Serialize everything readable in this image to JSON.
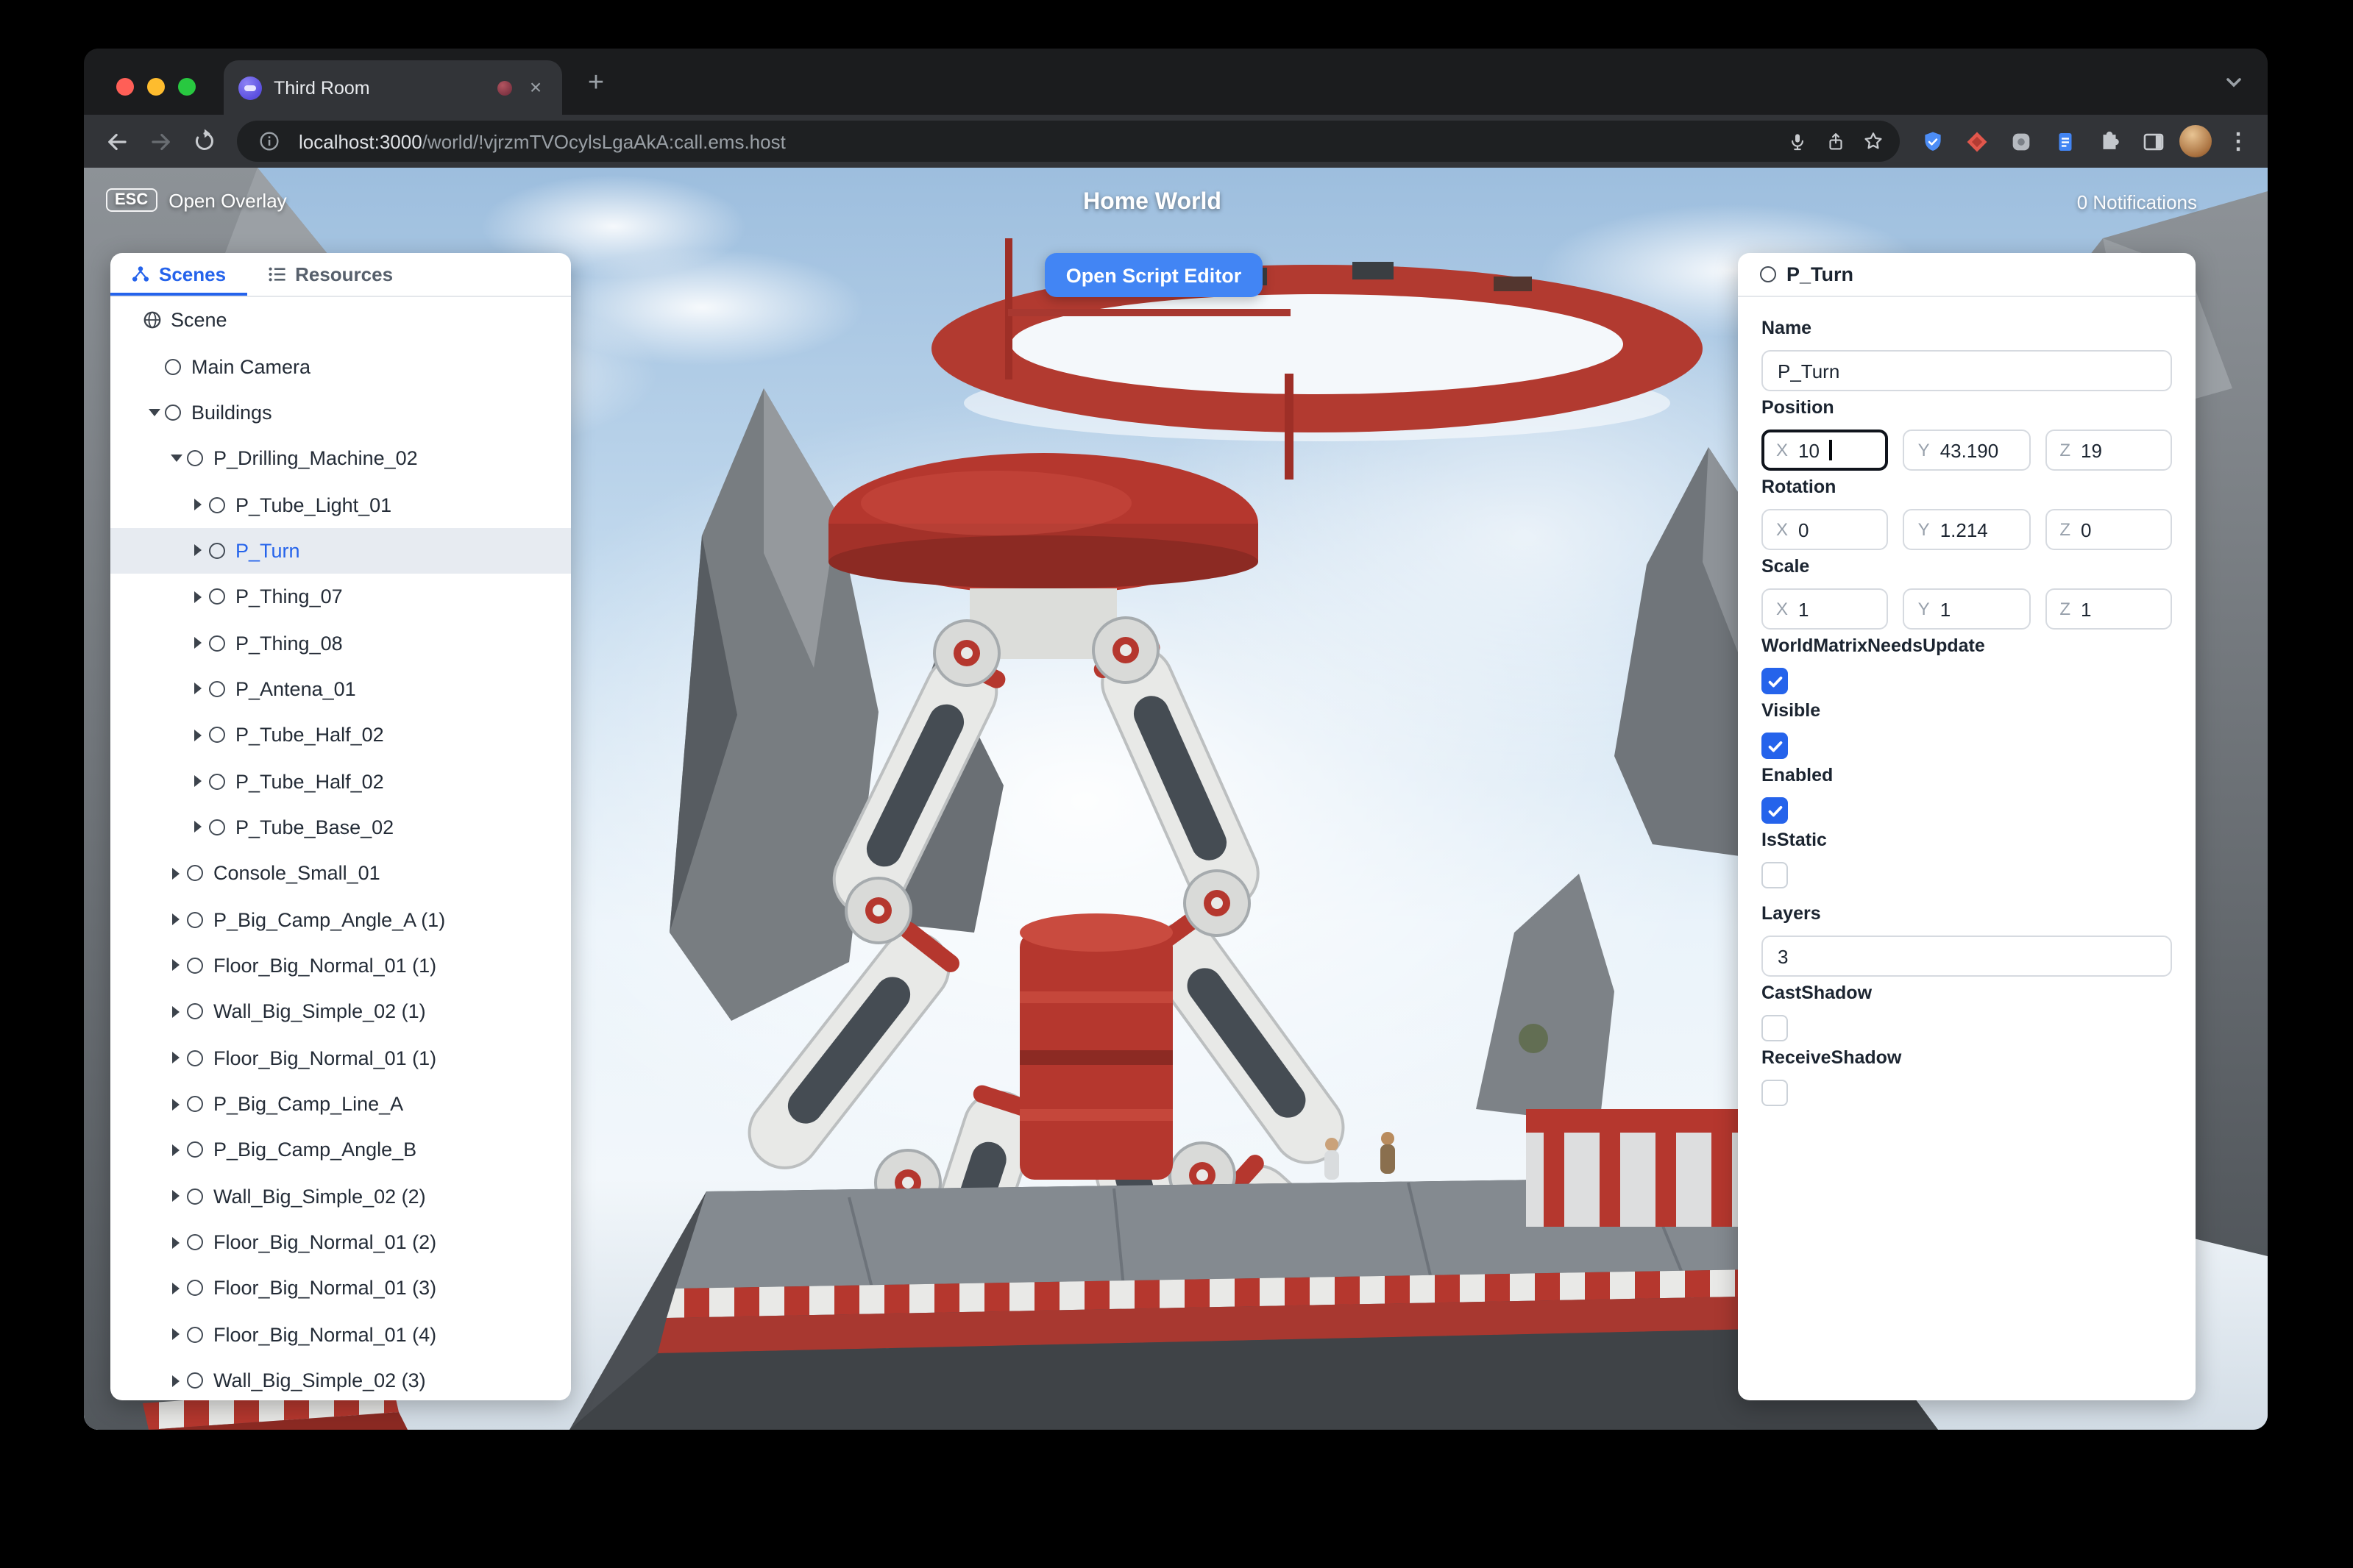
{
  "colors": {
    "accent_blue": "#2563eb",
    "button_blue": "#4285f4",
    "selected_row_bg": "#e7ebf1",
    "machine_red": "#b5372e"
  },
  "browser": {
    "tab_title": "Third Room",
    "close_tab_glyph": "×",
    "new_tab_glyph": "+",
    "overflow_glyph": "⋮",
    "url_host": "localhost:3000",
    "url_path": "/world/!vjrzmTVOcylsLgaAkA:call.ems.host"
  },
  "hud": {
    "esc_badge": "ESC",
    "open_overlay_label": "Open Overlay",
    "world_title": "Home World",
    "notifications_label": "0 Notifications",
    "open_script_editor_label": "Open Script Editor"
  },
  "left_panel": {
    "tabs": [
      {
        "label": "Scenes",
        "active": true
      },
      {
        "label": "Resources",
        "active": false
      }
    ],
    "tree": [
      {
        "label": "Scene",
        "depth": 0,
        "icon": "globe",
        "caret": null
      },
      {
        "label": "Main Camera",
        "depth": 1,
        "icon": "circle",
        "caret": null
      },
      {
        "label": "Buildings",
        "depth": 1,
        "icon": "circle",
        "caret": "down"
      },
      {
        "label": "P_Drilling_Machine_02",
        "depth": 2,
        "icon": "circle",
        "caret": "down"
      },
      {
        "label": "P_Tube_Light_01",
        "depth": 3,
        "icon": "circle",
        "caret": "right"
      },
      {
        "label": "P_Turn",
        "depth": 3,
        "icon": "circle",
        "caret": "right",
        "selected": true
      },
      {
        "label": "P_Thing_07",
        "depth": 3,
        "icon": "circle",
        "caret": "right"
      },
      {
        "label": "P_Thing_08",
        "depth": 3,
        "icon": "circle",
        "caret": "right"
      },
      {
        "label": "P_Antena_01",
        "depth": 3,
        "icon": "circle",
        "caret": "right"
      },
      {
        "label": "P_Tube_Half_02",
        "depth": 3,
        "icon": "circle",
        "caret": "right"
      },
      {
        "label": "P_Tube_Half_02",
        "depth": 3,
        "icon": "circle",
        "caret": "right"
      },
      {
        "label": "P_Tube_Base_02",
        "depth": 3,
        "icon": "circle",
        "caret": "right"
      },
      {
        "label": "Console_Small_01",
        "depth": 2,
        "icon": "circle",
        "caret": "right"
      },
      {
        "label": "P_Big_Camp_Angle_A (1)",
        "depth": 2,
        "icon": "circle",
        "caret": "right"
      },
      {
        "label": "Floor_Big_Normal_01 (1)",
        "depth": 2,
        "icon": "circle",
        "caret": "right"
      },
      {
        "label": "Wall_Big_Simple_02 (1)",
        "depth": 2,
        "icon": "circle",
        "caret": "right"
      },
      {
        "label": "Floor_Big_Normal_01 (1)",
        "depth": 2,
        "icon": "circle",
        "caret": "right"
      },
      {
        "label": "P_Big_Camp_Line_A",
        "depth": 2,
        "icon": "circle",
        "caret": "right"
      },
      {
        "label": "P_Big_Camp_Angle_B",
        "depth": 2,
        "icon": "circle",
        "caret": "right"
      },
      {
        "label": "Wall_Big_Simple_02 (2)",
        "depth": 2,
        "icon": "circle",
        "caret": "right"
      },
      {
        "label": "Floor_Big_Normal_01 (2)",
        "depth": 2,
        "icon": "circle",
        "caret": "right"
      },
      {
        "label": "Floor_Big_Normal_01 (3)",
        "depth": 2,
        "icon": "circle",
        "caret": "right"
      },
      {
        "label": "Floor_Big_Normal_01 (4)",
        "depth": 2,
        "icon": "circle",
        "caret": "right"
      },
      {
        "label": "Wall_Big_Simple_02 (3)",
        "depth": 2,
        "icon": "circle",
        "caret": "right"
      }
    ]
  },
  "inspector": {
    "header_title": "P_Turn",
    "axes": [
      "X",
      "Y",
      "Z"
    ],
    "focused_field": "position.x",
    "name_field": {
      "label": "Name",
      "value": "P_Turn"
    },
    "position": {
      "label": "Position",
      "x": "10",
      "y": "43.190",
      "z": "19"
    },
    "rotation": {
      "label": "Rotation",
      "x": "0",
      "y": "1.214",
      "z": "0"
    },
    "scale": {
      "label": "Scale",
      "x": "1",
      "y": "1",
      "z": "1"
    },
    "bool_fields": [
      {
        "label": "WorldMatrixNeedsUpdate",
        "checked": true
      },
      {
        "label": "Visible",
        "checked": true
      },
      {
        "label": "Enabled",
        "checked": true
      },
      {
        "label": "IsStatic",
        "checked": false
      }
    ],
    "layers_field": {
      "label": "Layers",
      "value": "3"
    },
    "shadow_fields": [
      {
        "label": "CastShadow",
        "checked": false
      },
      {
        "label": "ReceiveShadow",
        "checked": false
      }
    ]
  }
}
